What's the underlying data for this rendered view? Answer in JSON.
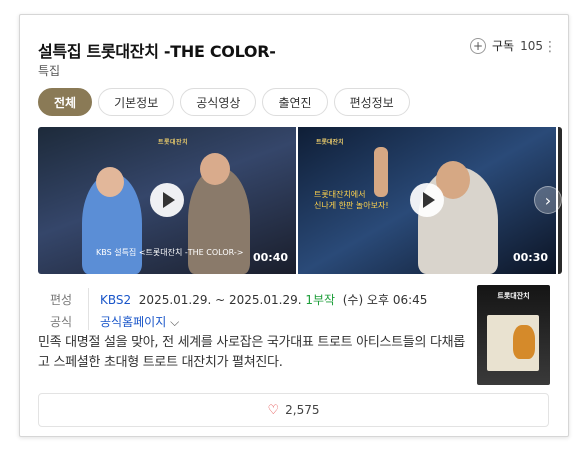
{
  "header": {
    "title": "설특집 트롯대잔치 -THE COLOR-",
    "category": "특집",
    "subscribe_label": "구독",
    "subscribe_count": "105",
    "more_icon": "more-vertical-icon"
  },
  "tabs": [
    {
      "label": "전체",
      "active": true
    },
    {
      "label": "기본정보",
      "active": false
    },
    {
      "label": "공식영상",
      "active": false
    },
    {
      "label": "출연진",
      "active": false
    },
    {
      "label": "편성정보",
      "active": false
    }
  ],
  "videos": [
    {
      "duration": "00:40",
      "caption": "KBS 설특집 <트롯대잔치 -THE COLOR->",
      "logo": "트롯대잔치"
    },
    {
      "duration": "00:30",
      "overlay": "트롯대잔치에서\n신나게 한판 놀아보자!",
      "logo": "트롯대잔치"
    }
  ],
  "info": {
    "schedule_label": "편성",
    "channel": "KBS2",
    "date_range": "2025.01.29. ~ 2025.01.29.",
    "episodes": "1부작",
    "time": "(수) 오후 06:45",
    "official_label": "공식",
    "official_link": "공식홈페이지"
  },
  "description": "민족 대명절 설을 맞아, 전 세계를 사로잡은 국가대표 트로트 아티스트들의 다채롭고 스페셜한 초대형 트로트 대잔치가 펼쳐진다.",
  "poster": {
    "title": "트롯대잔치"
  },
  "likes": {
    "count": "2,575"
  },
  "colors": {
    "active_tab": "#8a7a56",
    "link_blue": "#1a56c9",
    "green": "#1e9e3a",
    "heart": "#e03a3a"
  }
}
